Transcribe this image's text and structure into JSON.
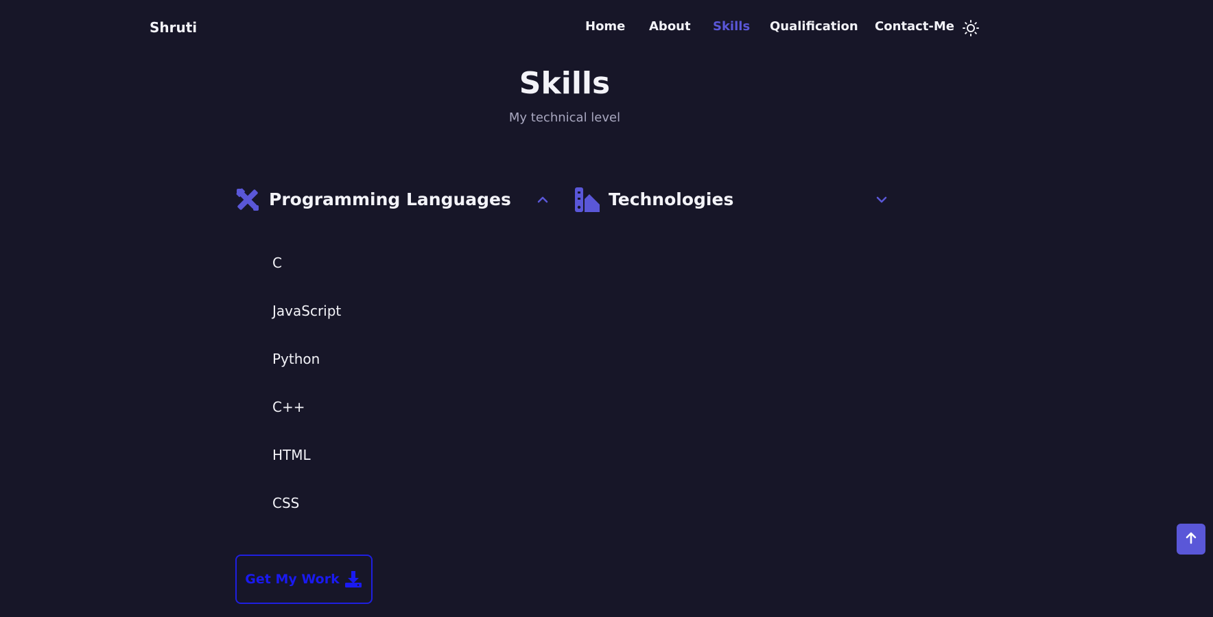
{
  "header": {
    "logo": "Shruti",
    "nav": [
      {
        "label": "Home",
        "active": false
      },
      {
        "label": "About",
        "active": false
      },
      {
        "label": "Skills",
        "active": true
      },
      {
        "label": "Qualification",
        "active": false
      },
      {
        "label": "Contact-Me",
        "active": false
      }
    ],
    "theme_icon": "sun-icon"
  },
  "section": {
    "title": "Skills",
    "subtitle": "My technical level"
  },
  "skill_groups": [
    {
      "title": "Programming Languages",
      "icon": "tools-icon",
      "expanded": true,
      "items": [
        "C",
        "JavaScript",
        "Python",
        "C++",
        "HTML",
        "CSS"
      ]
    },
    {
      "title": "Technologies",
      "icon": "swatchbook-icon",
      "expanded": false,
      "items": []
    }
  ],
  "cta": {
    "label": "Get My Work",
    "icon": "download-icon"
  },
  "scroll_top_icon": "arrow-up-icon",
  "colors": {
    "background": "#171628",
    "accent": "#5a57d8",
    "button": "#1a1af0",
    "text": "#f3f3f8",
    "muted": "#a9a8c0"
  }
}
